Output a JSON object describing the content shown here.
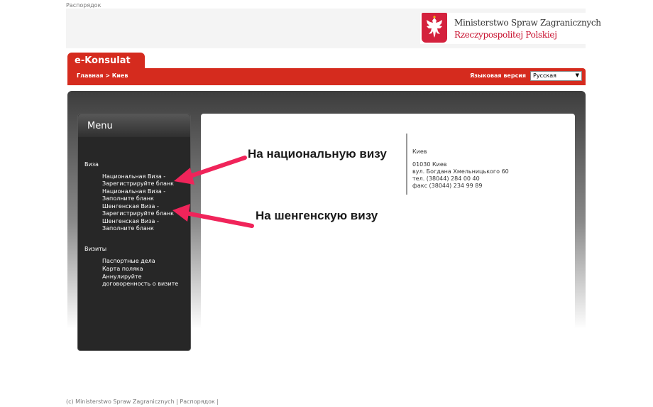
{
  "top_link": "Распорядок",
  "ministry": {
    "line1": "Ministerstwo Spraw Zagranicznych",
    "line2": "Rzeczypospolitej Polskiej"
  },
  "tab_label": "e-Konsulat",
  "breadcrumb": "Главная > Киев",
  "language": {
    "label": "Языковая версия",
    "selected": "Русская"
  },
  "menu": {
    "title": "Menu",
    "sections": [
      {
        "title": "Виза",
        "items": [
          [
            "Национальная Виза -",
            "Зарегистрируйте бланк"
          ],
          [
            "Национальная Виза -",
            "Заполните бланк"
          ],
          [
            "Шенгенская Виза -",
            "Зарегистрируйте бланк"
          ],
          [
            "Шенгенская Виза -",
            "Заполните бланк"
          ]
        ]
      },
      {
        "title": "Визиты",
        "items": [
          [
            "Паспортные дела"
          ],
          [
            "Карта поляка"
          ],
          [
            "Аннулируйте",
            "договоренность о визите"
          ]
        ]
      }
    ]
  },
  "address": {
    "city": "Киев",
    "postal": "01030 Киев",
    "street": "вул. Богдана Хмельницького 60",
    "phone": "тел. (38044) 284 00 40",
    "fax": "факс (38044) 234 99 89"
  },
  "annotations": {
    "national": "На национальную визу",
    "schengen": "На шенгенскую визу"
  },
  "footer": "(c) Ministerstwo Spraw Zagranicznych | Распорядок |",
  "colors": {
    "brand_red": "#d52b1e",
    "arrow": "#f0245a",
    "menu_bg": "#272727"
  }
}
